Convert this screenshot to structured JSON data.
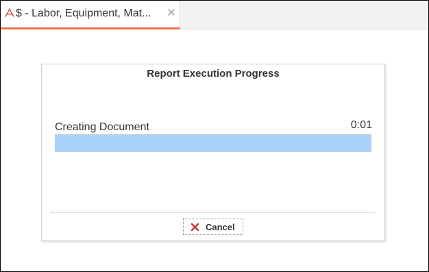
{
  "tab": {
    "title": "$ - Labor, Equipment, Mat...",
    "icon": "pdf-icon",
    "close_icon": "close-icon",
    "accent_color": "#e8734a"
  },
  "dialog": {
    "title": "Report Execution Progress",
    "status_label": "Creating Document",
    "elapsed_time": "0:01",
    "progress_fraction": 1.0,
    "progress_color": "#a8d1fb",
    "cancel_label": "Cancel",
    "cancel_icon": "cancel-x-icon",
    "cancel_icon_color": "#c93a3a"
  }
}
